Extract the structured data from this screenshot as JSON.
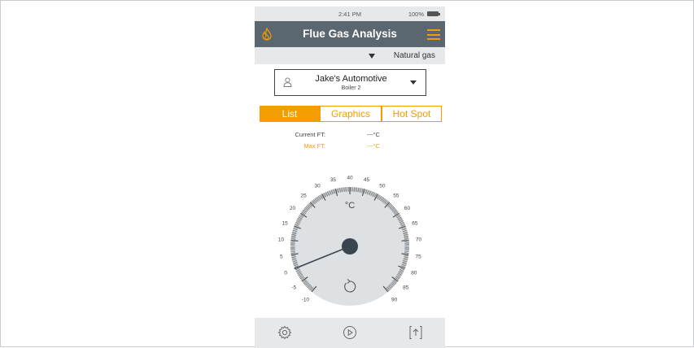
{
  "status_bar": {
    "time": "2:41 PM",
    "battery": "100%"
  },
  "header": {
    "title": "Flue Gas Analysis"
  },
  "fuel": {
    "selected": "Natural gas"
  },
  "customer": {
    "name": "Jake's Automotive",
    "location": "Boiler 2"
  },
  "tabs": [
    {
      "label": "List",
      "active": true
    },
    {
      "label": "Graphics",
      "active": false
    },
    {
      "label": "Hot Spot",
      "active": false
    }
  ],
  "readings": {
    "current_ft_label": "Current FT:",
    "current_ft_value": "---°C",
    "max_ft_label": "Max FT:",
    "max_ft_value": "---°C"
  },
  "gauge": {
    "unit": "°C",
    "min": -10,
    "max": 90,
    "tick_labels": [
      "-10",
      "-5",
      "0",
      "5",
      "10",
      "15",
      "20",
      "25",
      "30",
      "35",
      "40",
      "45",
      "50",
      "55",
      "60",
      "65",
      "70",
      "75",
      "80",
      "85",
      "90"
    ],
    "needle_value": 0
  },
  "bottom_bar": {
    "icons": [
      "settings-icon",
      "play-icon",
      "export-icon"
    ]
  },
  "colors": {
    "accent": "#f59c00",
    "header": "#5a6670",
    "panel": "#e6e8ea",
    "gauge_face": "#dde1e4",
    "hub": "#3a4550"
  }
}
